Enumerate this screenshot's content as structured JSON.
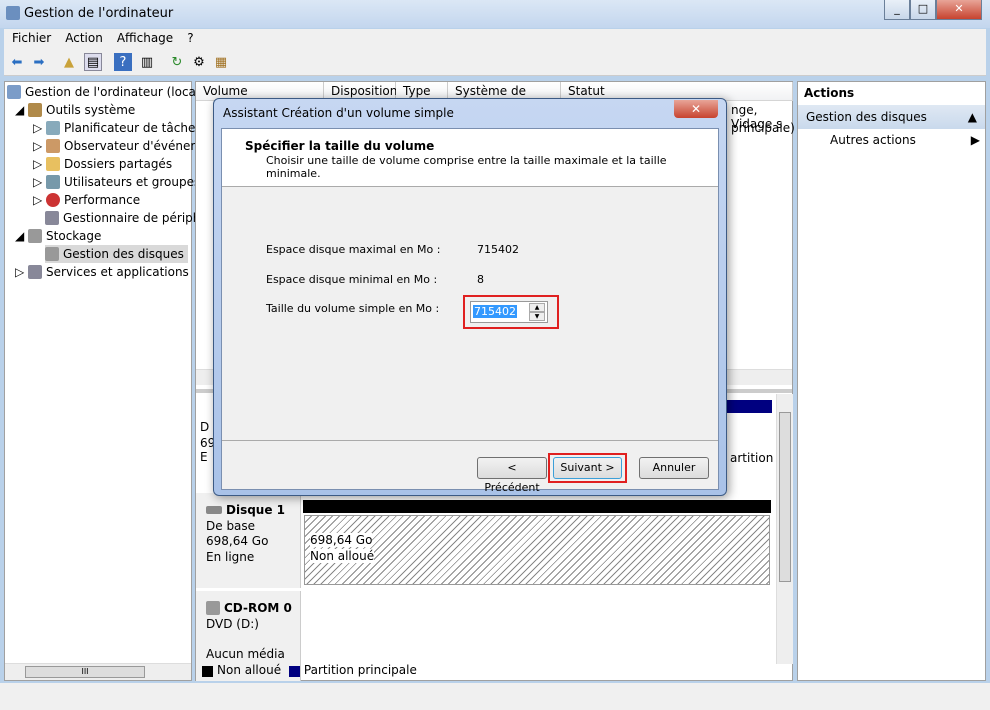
{
  "window": {
    "title": "Gestion de l'ordinateur",
    "min": "_",
    "max": "□",
    "close": "✕"
  },
  "menu": [
    "Fichier",
    "Action",
    "Affichage",
    "?"
  ],
  "tree": {
    "root": "Gestion de l'ordinateur (local)",
    "tools": "Outils système",
    "items": [
      "Planificateur de tâches",
      "Observateur d'événements",
      "Dossiers partagés",
      "Utilisateurs et groupes locaux",
      "Performance",
      "Gestionnaire de périphériques"
    ],
    "storage": "Stockage",
    "disks": "Gestion des disques",
    "services": "Services et applications"
  },
  "columns": [
    "Volume",
    "Disposition",
    "Type",
    "Système de fichiers",
    "Statut"
  ],
  "volume_rows_partial": [
    "nge, Vidage s",
    "principale)"
  ],
  "disks": [
    {
      "name": "Disque 1",
      "kind": "De base",
      "size": "698,64 Go",
      "state": "En ligne",
      "partition_size": "698,64 Go",
      "partition_label": "Non alloué"
    },
    {
      "name": "CD-ROM 0",
      "kind": "DVD (D:)",
      "state": "Aucun média"
    }
  ],
  "disk0_partial": {
    "l1": "D",
    "l2": "69",
    "l3": "E",
    "right": "artition"
  },
  "legend": [
    {
      "label": "Non alloué",
      "color": "#000000"
    },
    {
      "label": "Partition principale",
      "color": "#000080"
    }
  ],
  "actions": {
    "title": "Actions",
    "section": "Gestion des disques",
    "more": "Autres actions"
  },
  "dialog": {
    "title": "Assistant Création d'un volume simple",
    "close": "✕",
    "heading": "Spécifier la taille du volume",
    "subheading": "Choisir une taille de volume comprise entre la taille maximale et la taille minimale.",
    "max_label": "Espace disque maximal en Mo :",
    "max_value": "715402",
    "min_label": "Espace disque minimal en Mo :",
    "min_value": "8",
    "size_label": "Taille du volume simple en Mo :",
    "size_value": "715402",
    "back": "< Précédent",
    "next": "Suivant >",
    "cancel": "Annuler"
  },
  "scroll": {
    "h_thumb": "III"
  }
}
